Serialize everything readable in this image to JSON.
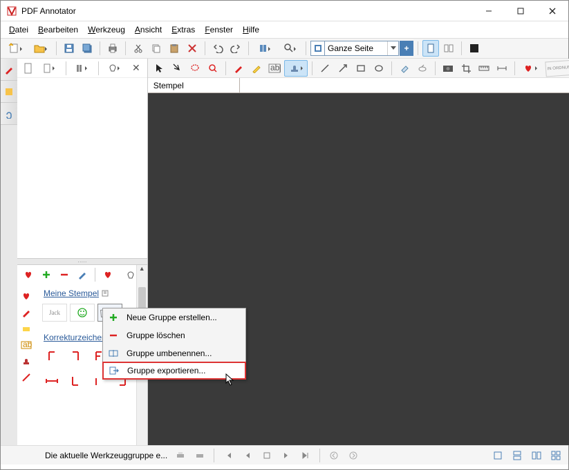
{
  "app": {
    "title": "PDF Annotator"
  },
  "menu": {
    "items": [
      "Datei",
      "Bearbeiten",
      "Werkzeug",
      "Ansicht",
      "Extras",
      "Fenster",
      "Hilfe"
    ]
  },
  "zoom": {
    "label": "Ganze Seite"
  },
  "doc": {
    "tab": "Stempel"
  },
  "panel": {
    "group1": "Meine Stempel",
    "group2": "Korrekturzeichen",
    "stamp_jack": "Jack"
  },
  "context": {
    "new_group": "Neue Gruppe erstellen...",
    "delete_group": "Gruppe löschen",
    "rename_group": "Gruppe umbenennen...",
    "export_group": "Gruppe exportieren..."
  },
  "status": {
    "text": "Die aktuelle Werkzeuggruppe e..."
  },
  "colors": {
    "accent": "#2a5a99",
    "red": "#d22",
    "highlight_border": "#d33"
  }
}
